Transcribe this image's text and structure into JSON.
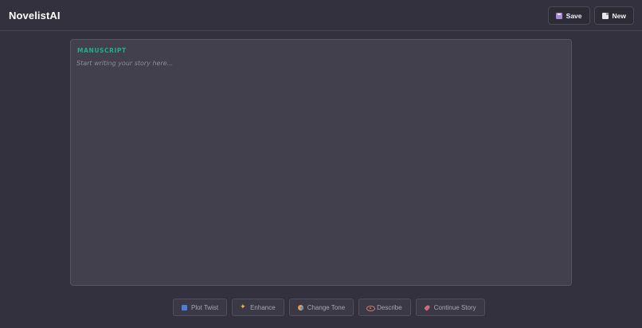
{
  "app": {
    "title": "NovelistAI"
  },
  "toolbar": {
    "save_label": "Save",
    "new_label": "New",
    "save_icon": "floppy-disk-icon",
    "new_icon": "document-icon"
  },
  "editor": {
    "section_label": "MANUSCRIPT",
    "placeholder": "Start writing your story here...",
    "value": ""
  },
  "ai_tools": [
    {
      "label": "Plot Twist",
      "icon": "plot-twist-icon"
    },
    {
      "label": "Enhance",
      "icon": "sparkles-icon"
    },
    {
      "label": "Change Tone",
      "icon": "masks-icon"
    },
    {
      "label": "Describe",
      "icon": "eye-icon"
    },
    {
      "label": "Continue Story",
      "icon": "rocket-icon"
    }
  ],
  "colors": {
    "background": "#32313d",
    "panel": "#41404c",
    "accent_label": "#1fae8b"
  }
}
